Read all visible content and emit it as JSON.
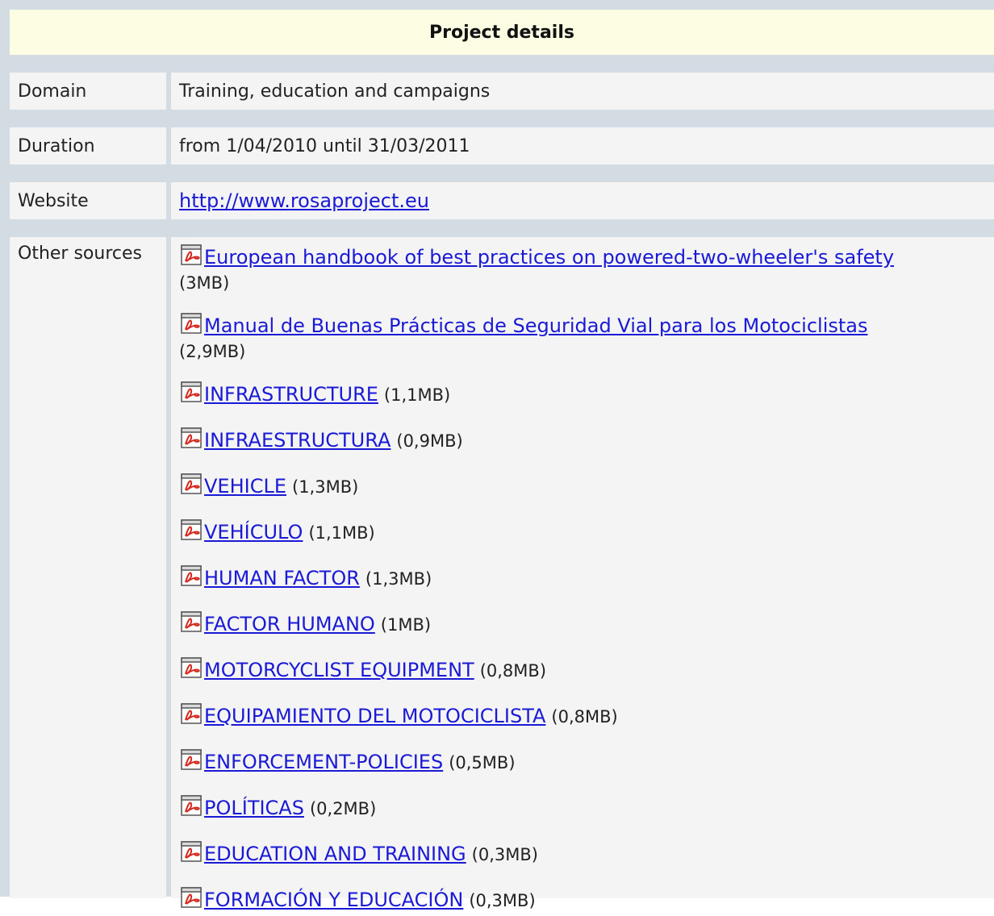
{
  "header": {
    "title": "Project details"
  },
  "rows": {
    "domain": {
      "label": "Domain",
      "value": "Training, education and campaigns"
    },
    "duration": {
      "label": "Duration",
      "value": "from 1/04/2010 until 31/03/2011"
    },
    "website": {
      "label": "Website",
      "link": "http://www.rosaproject.eu"
    },
    "other_sources": {
      "label": "Other sources"
    }
  },
  "sources": [
    {
      "icon": "pdf-icon",
      "title": "European handbook of best practices on powered-two-wheeler's safety",
      "size": "(3MB)"
    },
    {
      "icon": "pdf-icon",
      "title": "Manual de Buenas Prácticas de Seguridad Vial para los Motociclistas",
      "size": "(2,9MB)"
    },
    {
      "icon": "pdf-icon",
      "title": "INFRASTRUCTURE",
      "size": "(1,1MB)"
    },
    {
      "icon": "pdf-icon",
      "title": "INFRAESTRUCTURA",
      "size": "(0,9MB)"
    },
    {
      "icon": "pdf-icon",
      "title": "VEHICLE",
      "size": "(1,3MB)"
    },
    {
      "icon": "pdf-icon",
      "title": "VEHÍCULO",
      "size": "(1,1MB)"
    },
    {
      "icon": "pdf-icon",
      "title": "HUMAN FACTOR",
      "size": "(1,3MB)"
    },
    {
      "icon": "pdf-icon",
      "title": "FACTOR HUMANO",
      "size": "(1MB)"
    },
    {
      "icon": "pdf-icon",
      "title": "MOTORCYCLIST EQUIPMENT",
      "size": "(0,8MB)"
    },
    {
      "icon": "pdf-icon",
      "title": "EQUIPAMIENTO DEL MOTOCICLISTA",
      "size": "(0,8MB)"
    },
    {
      "icon": "pdf-icon",
      "title": "ENFORCEMENT-POLICIES",
      "size": "(0,5MB)"
    },
    {
      "icon": "pdf-icon",
      "title": "POLÍTICAS",
      "size": "(0,2MB)"
    },
    {
      "icon": "pdf-icon",
      "title": "EDUCATION AND TRAINING",
      "size": "(0,3MB)"
    },
    {
      "icon": "pdf-icon",
      "title": "FORMACIÓN Y EDUCACIÓN",
      "size": "(0,3MB)"
    }
  ],
  "colors": {
    "frame": "#d3dce3",
    "header_bg": "#fdfde3",
    "cell_bg": "#f4f4f4",
    "link": "#1a1ad6",
    "pdf_red": "#d42a1f"
  }
}
